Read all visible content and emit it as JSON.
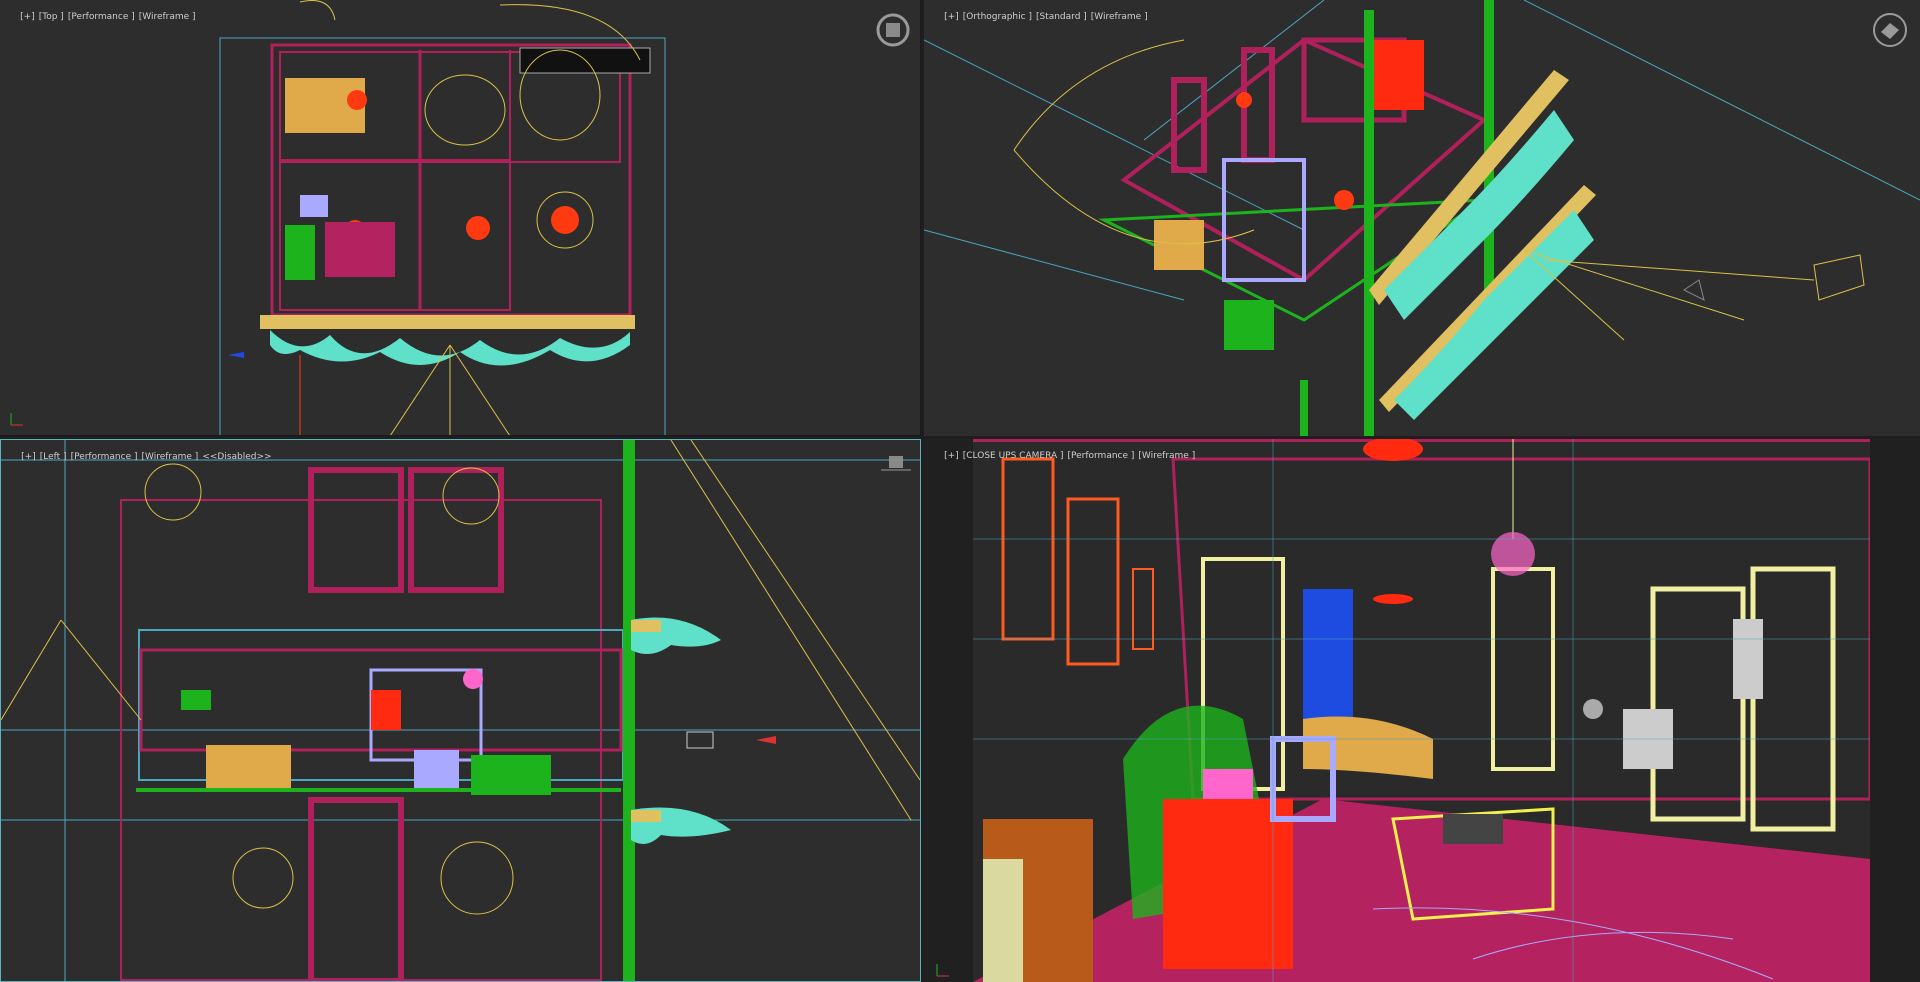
{
  "viewports": {
    "top": {
      "labels": [
        "[+]",
        "[Top ]",
        "[Performance ]",
        "[Wireframe ]"
      ]
    },
    "ortho": {
      "labels": [
        "[+]",
        "[Orthographic ]",
        "[Standard ]",
        "[Wireframe ]"
      ]
    },
    "left": {
      "labels": [
        "[+]",
        "[Left ]",
        "[Performance ]",
        "[Wireframe ]",
        "<<Disabled>>"
      ]
    },
    "camera": {
      "labels": [
        "[+]",
        "[CLOSE UPS CAMERA ]",
        "[Performance ]",
        "[Wireframe ]"
      ]
    }
  },
  "icons": {
    "viewcube": "viewcube-icon",
    "axis": "axis-tripod-icon",
    "home": "home-cube-icon"
  },
  "colors": {
    "viewport_bg": "#2d2d2d",
    "active_border": "#5fb3c0",
    "wire_magenta": "#b0205a",
    "wire_green": "#1db31d",
    "wire_yellow": "#d9c24a",
    "wire_teal": "#5fe0c8",
    "wire_red": "#ff2a10",
    "wire_lavender": "#a9a9ff",
    "wire_cyan": "#4aa8c0"
  }
}
